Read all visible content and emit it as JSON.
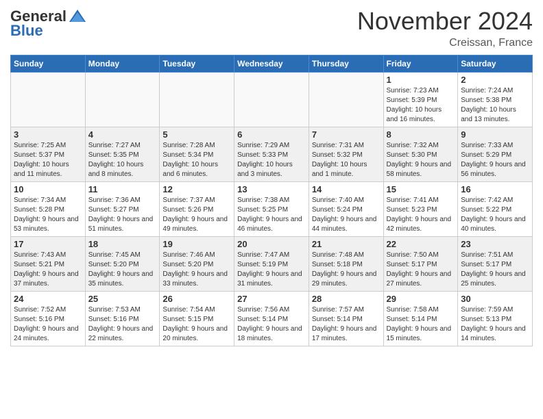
{
  "header": {
    "logo_general": "General",
    "logo_blue": "Blue",
    "month_title": "November 2024",
    "location": "Creissan, France"
  },
  "calendar": {
    "days_of_week": [
      "Sunday",
      "Monday",
      "Tuesday",
      "Wednesday",
      "Thursday",
      "Friday",
      "Saturday"
    ],
    "weeks": [
      [
        {
          "num": "",
          "info": "",
          "empty": true
        },
        {
          "num": "",
          "info": "",
          "empty": true
        },
        {
          "num": "",
          "info": "",
          "empty": true
        },
        {
          "num": "",
          "info": "",
          "empty": true
        },
        {
          "num": "",
          "info": "",
          "empty": true
        },
        {
          "num": "1",
          "info": "Sunrise: 7:23 AM\nSunset: 5:39 PM\nDaylight: 10 hours and 16 minutes."
        },
        {
          "num": "2",
          "info": "Sunrise: 7:24 AM\nSunset: 5:38 PM\nDaylight: 10 hours and 13 minutes."
        }
      ],
      [
        {
          "num": "3",
          "info": "Sunrise: 7:25 AM\nSunset: 5:37 PM\nDaylight: 10 hours and 11 minutes."
        },
        {
          "num": "4",
          "info": "Sunrise: 7:27 AM\nSunset: 5:35 PM\nDaylight: 10 hours and 8 minutes."
        },
        {
          "num": "5",
          "info": "Sunrise: 7:28 AM\nSunset: 5:34 PM\nDaylight: 10 hours and 6 minutes."
        },
        {
          "num": "6",
          "info": "Sunrise: 7:29 AM\nSunset: 5:33 PM\nDaylight: 10 hours and 3 minutes."
        },
        {
          "num": "7",
          "info": "Sunrise: 7:31 AM\nSunset: 5:32 PM\nDaylight: 10 hours and 1 minute."
        },
        {
          "num": "8",
          "info": "Sunrise: 7:32 AM\nSunset: 5:30 PM\nDaylight: 9 hours and 58 minutes."
        },
        {
          "num": "9",
          "info": "Sunrise: 7:33 AM\nSunset: 5:29 PM\nDaylight: 9 hours and 56 minutes."
        }
      ],
      [
        {
          "num": "10",
          "info": "Sunrise: 7:34 AM\nSunset: 5:28 PM\nDaylight: 9 hours and 53 minutes."
        },
        {
          "num": "11",
          "info": "Sunrise: 7:36 AM\nSunset: 5:27 PM\nDaylight: 9 hours and 51 minutes."
        },
        {
          "num": "12",
          "info": "Sunrise: 7:37 AM\nSunset: 5:26 PM\nDaylight: 9 hours and 49 minutes."
        },
        {
          "num": "13",
          "info": "Sunrise: 7:38 AM\nSunset: 5:25 PM\nDaylight: 9 hours and 46 minutes."
        },
        {
          "num": "14",
          "info": "Sunrise: 7:40 AM\nSunset: 5:24 PM\nDaylight: 9 hours and 44 minutes."
        },
        {
          "num": "15",
          "info": "Sunrise: 7:41 AM\nSunset: 5:23 PM\nDaylight: 9 hours and 42 minutes."
        },
        {
          "num": "16",
          "info": "Sunrise: 7:42 AM\nSunset: 5:22 PM\nDaylight: 9 hours and 40 minutes."
        }
      ],
      [
        {
          "num": "17",
          "info": "Sunrise: 7:43 AM\nSunset: 5:21 PM\nDaylight: 9 hours and 37 minutes."
        },
        {
          "num": "18",
          "info": "Sunrise: 7:45 AM\nSunset: 5:20 PM\nDaylight: 9 hours and 35 minutes."
        },
        {
          "num": "19",
          "info": "Sunrise: 7:46 AM\nSunset: 5:20 PM\nDaylight: 9 hours and 33 minutes."
        },
        {
          "num": "20",
          "info": "Sunrise: 7:47 AM\nSunset: 5:19 PM\nDaylight: 9 hours and 31 minutes."
        },
        {
          "num": "21",
          "info": "Sunrise: 7:48 AM\nSunset: 5:18 PM\nDaylight: 9 hours and 29 minutes."
        },
        {
          "num": "22",
          "info": "Sunrise: 7:50 AM\nSunset: 5:17 PM\nDaylight: 9 hours and 27 minutes."
        },
        {
          "num": "23",
          "info": "Sunrise: 7:51 AM\nSunset: 5:17 PM\nDaylight: 9 hours and 25 minutes."
        }
      ],
      [
        {
          "num": "24",
          "info": "Sunrise: 7:52 AM\nSunset: 5:16 PM\nDaylight: 9 hours and 24 minutes."
        },
        {
          "num": "25",
          "info": "Sunrise: 7:53 AM\nSunset: 5:16 PM\nDaylight: 9 hours and 22 minutes."
        },
        {
          "num": "26",
          "info": "Sunrise: 7:54 AM\nSunset: 5:15 PM\nDaylight: 9 hours and 20 minutes."
        },
        {
          "num": "27",
          "info": "Sunrise: 7:56 AM\nSunset: 5:14 PM\nDaylight: 9 hours and 18 minutes."
        },
        {
          "num": "28",
          "info": "Sunrise: 7:57 AM\nSunset: 5:14 PM\nDaylight: 9 hours and 17 minutes."
        },
        {
          "num": "29",
          "info": "Sunrise: 7:58 AM\nSunset: 5:14 PM\nDaylight: 9 hours and 15 minutes."
        },
        {
          "num": "30",
          "info": "Sunrise: 7:59 AM\nSunset: 5:13 PM\nDaylight: 9 hours and 14 minutes."
        }
      ]
    ]
  }
}
